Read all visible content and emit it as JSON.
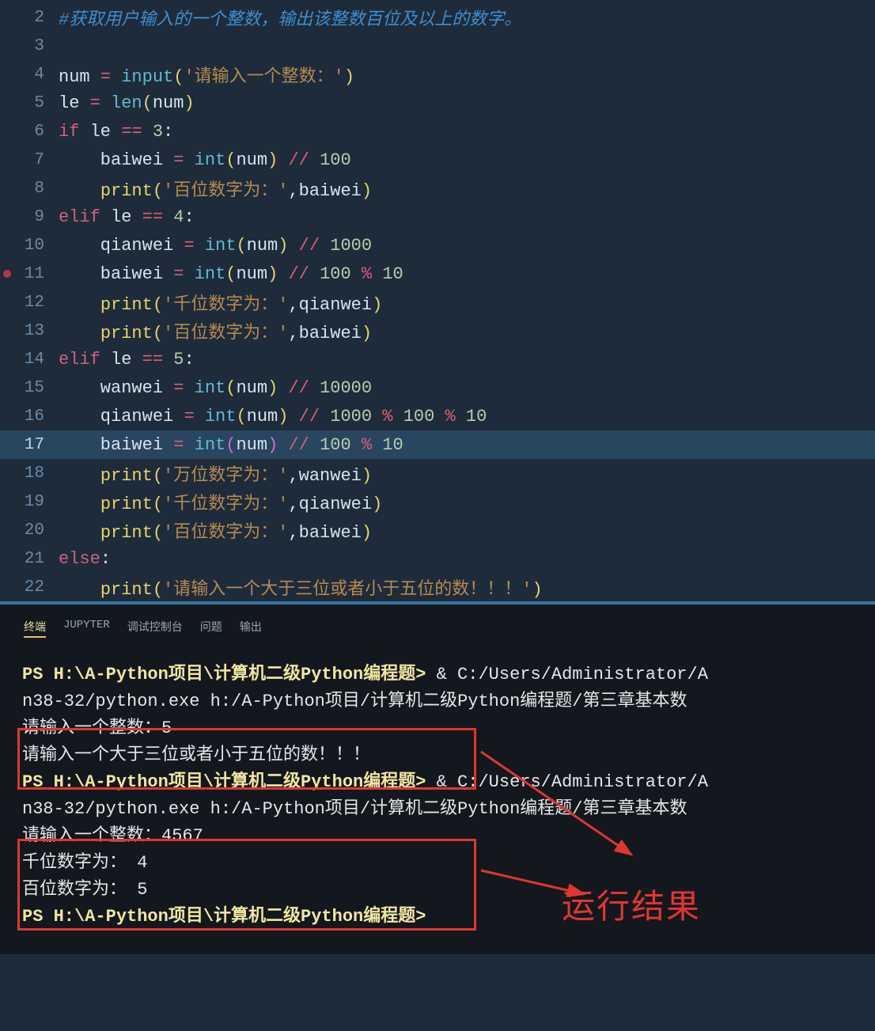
{
  "editor": {
    "lines": [
      {
        "num": "2",
        "tokens": [
          [
            "c-comment",
            "#获取用户输入的一个整数，输出该整数百位及以上的数字。"
          ]
        ]
      },
      {
        "num": "3",
        "tokens": []
      },
      {
        "num": "4",
        "tokens": [
          [
            "c-ident",
            "num "
          ],
          [
            "c-assign",
            "="
          ],
          [
            "c-ident",
            " "
          ],
          [
            "c-func",
            "input"
          ],
          [
            "c-paren",
            "("
          ],
          [
            "c-string",
            "'请输入一个整数：'"
          ],
          [
            "c-paren",
            ")"
          ]
        ]
      },
      {
        "num": "5",
        "tokens": [
          [
            "c-ident",
            "le "
          ],
          [
            "c-assign",
            "="
          ],
          [
            "c-ident",
            " "
          ],
          [
            "c-func",
            "len"
          ],
          [
            "c-paren",
            "("
          ],
          [
            "c-ident",
            "num"
          ],
          [
            "c-paren",
            ")"
          ]
        ]
      },
      {
        "num": "6",
        "tokens": [
          [
            "c-keyword",
            "if"
          ],
          [
            "c-ident",
            " le "
          ],
          [
            "c-op",
            "=="
          ],
          [
            "c-ident",
            " "
          ],
          [
            "c-num",
            "3"
          ],
          [
            "c-ident",
            ":"
          ]
        ]
      },
      {
        "num": "7",
        "tokens": [
          [
            "c-ident",
            "    baiwei "
          ],
          [
            "c-assign",
            "="
          ],
          [
            "c-ident",
            " "
          ],
          [
            "c-func",
            "int"
          ],
          [
            "c-paren",
            "("
          ],
          [
            "c-ident",
            "num"
          ],
          [
            "c-paren",
            ")"
          ],
          [
            "c-ident",
            " "
          ],
          [
            "c-op",
            "//"
          ],
          [
            "c-ident",
            " "
          ],
          [
            "c-num",
            "100"
          ]
        ]
      },
      {
        "num": "8",
        "tokens": [
          [
            "c-ident",
            "    "
          ],
          [
            "c-call",
            "print"
          ],
          [
            "c-paren",
            "("
          ],
          [
            "c-string",
            "'百位数字为：'"
          ],
          [
            "c-ident",
            ",baiwei"
          ],
          [
            "c-paren",
            ")"
          ]
        ]
      },
      {
        "num": "9",
        "tokens": [
          [
            "c-keyword",
            "elif"
          ],
          [
            "c-ident",
            " le "
          ],
          [
            "c-op",
            "=="
          ],
          [
            "c-ident",
            " "
          ],
          [
            "c-num",
            "4"
          ],
          [
            "c-ident",
            ":"
          ]
        ]
      },
      {
        "num": "10",
        "tokens": [
          [
            "c-ident",
            "    qianwei "
          ],
          [
            "c-assign",
            "="
          ],
          [
            "c-ident",
            " "
          ],
          [
            "c-func",
            "int"
          ],
          [
            "c-paren",
            "("
          ],
          [
            "c-ident",
            "num"
          ],
          [
            "c-paren",
            ")"
          ],
          [
            "c-ident",
            " "
          ],
          [
            "c-op",
            "//"
          ],
          [
            "c-ident",
            " "
          ],
          [
            "c-num",
            "1000"
          ]
        ]
      },
      {
        "num": "11",
        "tokens": [
          [
            "c-ident",
            "    baiwei "
          ],
          [
            "c-assign",
            "="
          ],
          [
            "c-ident",
            " "
          ],
          [
            "c-func",
            "int"
          ],
          [
            "c-paren",
            "("
          ],
          [
            "c-ident",
            "num"
          ],
          [
            "c-paren",
            ")"
          ],
          [
            "c-ident",
            " "
          ],
          [
            "c-op",
            "//"
          ],
          [
            "c-ident",
            " "
          ],
          [
            "c-num",
            "100"
          ],
          [
            "c-ident",
            " "
          ],
          [
            "c-op",
            "%"
          ],
          [
            "c-ident",
            " "
          ],
          [
            "c-num",
            "10"
          ]
        ],
        "breakpoint": true
      },
      {
        "num": "12",
        "tokens": [
          [
            "c-ident",
            "    "
          ],
          [
            "c-call",
            "print"
          ],
          [
            "c-paren",
            "("
          ],
          [
            "c-string",
            "'千位数字为：'"
          ],
          [
            "c-ident",
            ",qianwei"
          ],
          [
            "c-paren",
            ")"
          ]
        ]
      },
      {
        "num": "13",
        "tokens": [
          [
            "c-ident",
            "    "
          ],
          [
            "c-call",
            "print"
          ],
          [
            "c-paren",
            "("
          ],
          [
            "c-string",
            "'百位数字为：'"
          ],
          [
            "c-ident",
            ",baiwei"
          ],
          [
            "c-paren",
            ")"
          ]
        ]
      },
      {
        "num": "14",
        "tokens": [
          [
            "c-keyword",
            "elif"
          ],
          [
            "c-ident",
            " le "
          ],
          [
            "c-op",
            "=="
          ],
          [
            "c-ident",
            " "
          ],
          [
            "c-num",
            "5"
          ],
          [
            "c-ident",
            ":"
          ]
        ]
      },
      {
        "num": "15",
        "tokens": [
          [
            "c-ident",
            "    wanwei "
          ],
          [
            "c-assign",
            "="
          ],
          [
            "c-ident",
            " "
          ],
          [
            "c-func",
            "int"
          ],
          [
            "c-paren",
            "("
          ],
          [
            "c-ident",
            "num"
          ],
          [
            "c-paren",
            ")"
          ],
          [
            "c-ident",
            " "
          ],
          [
            "c-op",
            "//"
          ],
          [
            "c-ident",
            " "
          ],
          [
            "c-num",
            "10000"
          ]
        ]
      },
      {
        "num": "16",
        "tokens": [
          [
            "c-ident",
            "    qianwei "
          ],
          [
            "c-assign",
            "="
          ],
          [
            "c-ident",
            " "
          ],
          [
            "c-func",
            "int"
          ],
          [
            "c-paren",
            "("
          ],
          [
            "c-ident",
            "num"
          ],
          [
            "c-paren",
            ")"
          ],
          [
            "c-ident",
            " "
          ],
          [
            "c-op",
            "//"
          ],
          [
            "c-ident",
            " "
          ],
          [
            "c-num",
            "1000"
          ],
          [
            "c-ident",
            " "
          ],
          [
            "c-op",
            "%"
          ],
          [
            "c-ident",
            " "
          ],
          [
            "c-num",
            "100"
          ],
          [
            "c-ident",
            " "
          ],
          [
            "c-op",
            "%"
          ],
          [
            "c-ident",
            " "
          ],
          [
            "c-num",
            "10"
          ]
        ]
      },
      {
        "num": "17",
        "tokens": [
          [
            "c-ident",
            "    baiwei "
          ],
          [
            "c-assign",
            "="
          ],
          [
            "c-ident",
            " "
          ],
          [
            "c-func",
            "int"
          ],
          [
            "c-paren-b",
            "("
          ],
          [
            "c-ident",
            "num"
          ],
          [
            "c-paren-b",
            ")"
          ],
          [
            "c-ident",
            " "
          ],
          [
            "c-op",
            "//"
          ],
          [
            "c-ident",
            " "
          ],
          [
            "c-num",
            "100"
          ],
          [
            "c-ident",
            " "
          ],
          [
            "c-op",
            "%"
          ],
          [
            "c-ident",
            " "
          ],
          [
            "c-num",
            "10"
          ]
        ],
        "highlight": true
      },
      {
        "num": "18",
        "tokens": [
          [
            "c-ident",
            "    "
          ],
          [
            "c-call",
            "print"
          ],
          [
            "c-paren",
            "("
          ],
          [
            "c-string",
            "'万位数字为：'"
          ],
          [
            "c-ident",
            ",wanwei"
          ],
          [
            "c-paren",
            ")"
          ]
        ]
      },
      {
        "num": "19",
        "tokens": [
          [
            "c-ident",
            "    "
          ],
          [
            "c-call",
            "print"
          ],
          [
            "c-paren",
            "("
          ],
          [
            "c-string",
            "'千位数字为：'"
          ],
          [
            "c-ident",
            ",qianwei"
          ],
          [
            "c-paren",
            ")"
          ]
        ]
      },
      {
        "num": "20",
        "tokens": [
          [
            "c-ident",
            "    "
          ],
          [
            "c-call",
            "print"
          ],
          [
            "c-paren",
            "("
          ],
          [
            "c-string",
            "'百位数字为：'"
          ],
          [
            "c-ident",
            ",baiwei"
          ],
          [
            "c-paren",
            ")"
          ]
        ]
      },
      {
        "num": "21",
        "tokens": [
          [
            "c-keyword",
            "else"
          ],
          [
            "c-ident",
            ":"
          ]
        ]
      },
      {
        "num": "22",
        "tokens": [
          [
            "c-ident",
            "    "
          ],
          [
            "c-call",
            "print"
          ],
          [
            "c-paren",
            "("
          ],
          [
            "c-string",
            "'请输入一个大于三位或者小于五位的数！！！'"
          ],
          [
            "c-paren",
            ")"
          ]
        ]
      }
    ]
  },
  "panel": {
    "tabs": [
      "终端",
      "JUPYTER",
      "调试控制台",
      "问题",
      "输出"
    ],
    "active_tab": 0
  },
  "terminal": {
    "lines": [
      {
        "segments": [
          [
            "prompt-path",
            "PS H:\\A-Python项目\\计算机二级Python编程题>"
          ],
          [
            "plain",
            " & C:/Users/Administrator/A"
          ]
        ]
      },
      {
        "segments": [
          [
            "plain",
            "n38-32/python.exe h:/A-Python项目/计算机二级Python编程题/第三章基本数"
          ]
        ]
      },
      {
        "segments": [
          [
            "plain",
            "请输入一个整数：5"
          ]
        ]
      },
      {
        "segments": [
          [
            "plain",
            "请输入一个大于三位或者小于五位的数！！！"
          ]
        ]
      },
      {
        "segments": [
          [
            "prompt-path",
            "PS H:\\A-Python项目\\计算机二级Python编程题>"
          ],
          [
            "plain",
            " & C:/Users/Administrator/A"
          ]
        ]
      },
      {
        "segments": [
          [
            "plain",
            "n38-32/python.exe h:/A-Python项目/计算机二级Python编程题/第三章基本数"
          ]
        ]
      },
      {
        "segments": [
          [
            "plain",
            "请输入一个整数：4567"
          ]
        ]
      },
      {
        "segments": [
          [
            "plain",
            "千位数字为： 4"
          ]
        ]
      },
      {
        "segments": [
          [
            "plain",
            "百位数字为： 5"
          ]
        ]
      },
      {
        "segments": [
          [
            "prompt-path",
            "PS H:\\A-Python项目\\计算机二级Python编程题>"
          ],
          [
            "plain",
            " "
          ]
        ]
      }
    ]
  },
  "annotation": {
    "text": "运行结果"
  }
}
